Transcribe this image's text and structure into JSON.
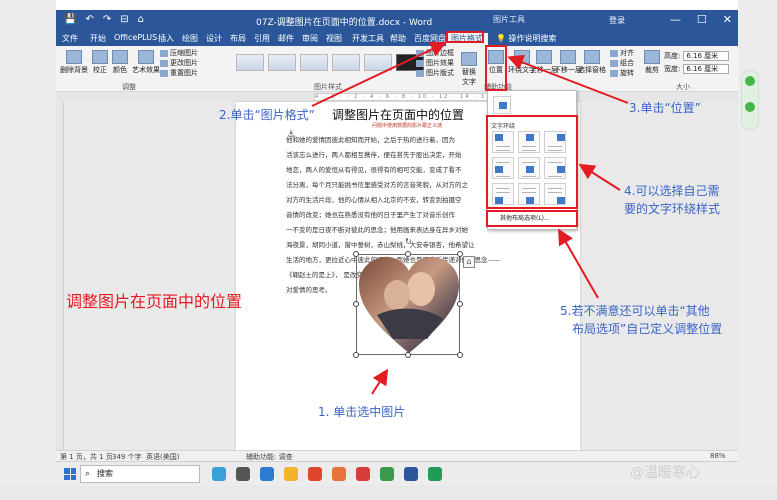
{
  "titlebar": {
    "quick_access": [
      "💾",
      "↶",
      "↷",
      "⊟",
      "⌂"
    ],
    "doc_title": "07Z-调整图片在页面中的位置.docx - Word",
    "contextual_label": "图片工具",
    "login": "登录",
    "controls": [
      "—",
      "☐",
      "✕"
    ]
  },
  "tabs": {
    "items": [
      "文件",
      "开始",
      "OfficePLUS",
      "插入",
      "绘图",
      "设计",
      "布局",
      "引用",
      "邮件",
      "审阅",
      "视图",
      "开发工具",
      "帮助",
      "百度网盘"
    ],
    "active": "图片格式",
    "tellme": "操作说明搜索"
  },
  "ribbon": {
    "adjust": {
      "remove_bg": "删除背景",
      "correct": "校正",
      "color": "颜色",
      "artistic": "艺术效果",
      "compress": "压缩图片",
      "change": "更改图片",
      "reset": "重置图片",
      "group_label": "调整"
    },
    "styles": {
      "group_label": "图片样式",
      "border": "图片边框",
      "effects": "图片效果",
      "layout": "图片版式"
    },
    "alt_text": "替换文字",
    "accessibility": "辅助功能",
    "arrange": {
      "position": "位置",
      "wrap": "环绕文字",
      "forward": "上移一层",
      "backward": "下移一层",
      "selection": "选择窗格",
      "align": "对齐",
      "group": "组合",
      "rotate": "旋转"
    },
    "size": {
      "crop": "裁剪",
      "height_label": "高度:",
      "height": "6.16 厘米",
      "width_label": "宽度:",
      "width": "6.16 厘米",
      "group_label": "大小"
    }
  },
  "ruler": {
    "ticks": "4 · 2 · · 2 · 4 · 6 · 8 · 10 · 12 · 14 · 16 · 18 · 20 · 22 · 24 · 26"
  },
  "document": {
    "heading": "调整图片在页面中的位置",
    "source": "问题中使用数据的影片跟正义通",
    "paragraphs": [
      "他和她的爱情因彼此相知而开始，之后于热的进行着，因为",
      "活该忘么进行，两人都相互携伴，便在甚先于股出决定，开始",
      "地恋，两人的爱恒从有得见，很得有的相可交能，变成了看不",
      "法分离，每个月只能挑书信里感受对方的言音笑貌，从对方的之",
      "对方的生活片段，他的心情从相入北京的不安，转变到拍摄空",
      "音情的改变；她也在熟悉没有他的日子里产生了对音乐创作",
      "一不变的是日夜不断对彼此的思念；他用画来表达身在异乡对她",
      "海夜景，胡同小道，窗中誓树，赤山梨桃，大安寺银杏，他希望让",
      "生活的地方，更拉近心中彼此的距离；而她也是用音乐传递对他的思念——",
      "《翱赵土的是上》，                                                  是改变了》是她",
      "对爱情的思考。"
    ],
    "anchor": "⚓"
  },
  "picture": {
    "rotate_glyph": "↻",
    "layout_glyph": "⌂"
  },
  "position_menu": {
    "inline_title": "嵌入文本行中",
    "wrap_title": "文字环绕",
    "more": "其他布局选项(L)..."
  },
  "annotations": {
    "a1": "1. 单击选中图片",
    "a2": "2.单击“图片格式”",
    "a3": "3.单击“位置”",
    "a4_line1": "4.可以选择自己需",
    "a4_line2": "要的文字环绕样式",
    "a5_line1": "5.若不满意还可以单击“其他",
    "a5_line2": "布局选项”自己定义调整位置",
    "big_red": "调整图片在页面中的位置"
  },
  "statusbar": {
    "page": "第 1 页，共 1 页",
    "words": "349 个字",
    "lang": "英语(美国)",
    "accessibility": "辅助功能: 调查",
    "zoom": "88%"
  },
  "taskbar": {
    "search": "搜索",
    "watermark": "@温暖寒心"
  },
  "colors": {
    "accent": "#2b579a",
    "annotation_red": "#e31b23",
    "annotation_blue": "#3a63c7"
  }
}
